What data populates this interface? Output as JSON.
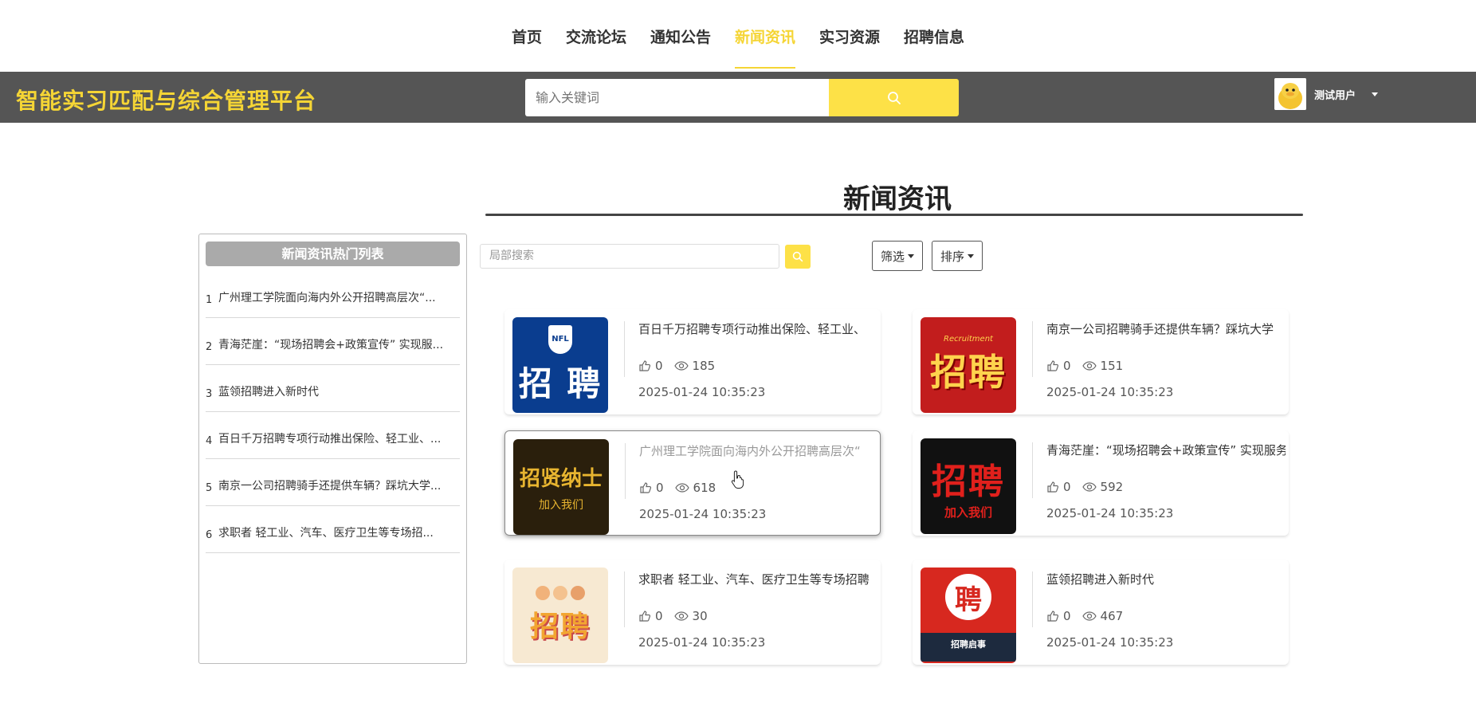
{
  "nav": {
    "items": [
      {
        "label": "首页",
        "active": false
      },
      {
        "label": "交流论坛",
        "active": false
      },
      {
        "label": "通知公告",
        "active": false
      },
      {
        "label": "新闻资讯",
        "active": true
      },
      {
        "label": "实习资源",
        "active": false
      },
      {
        "label": "招聘信息",
        "active": false
      }
    ]
  },
  "header": {
    "brand": "智能实习匹配与综合管理平台",
    "search_placeholder": "输入关键词",
    "user_name": "测试用户"
  },
  "page": {
    "title": "新闻资讯",
    "local_search_placeholder": "局部搜索",
    "filter_label": "筛选",
    "sort_label": "排序"
  },
  "sidebar": {
    "title": "新闻资讯热门列表",
    "items": [
      {
        "idx": "1",
        "text": "广州理工学院面向海内外公开招聘高层次“..."
      },
      {
        "idx": "2",
        "text": "青海茫崖：“现场招聘会+政策宣传” 实现服..."
      },
      {
        "idx": "3",
        "text": "蓝领招聘进入新时代"
      },
      {
        "idx": "4",
        "text": "百日千万招聘专项行动推出保险、轻工业、..."
      },
      {
        "idx": "5",
        "text": "南京一公司招聘骑手还提供车辆？踩坑大学..."
      },
      {
        "idx": "6",
        "text": "求职者 轻工业、汽车、医疗卫生等专场招..."
      }
    ]
  },
  "cards": [
    {
      "title": "百日千万招聘专项行动推出保险、轻工业、",
      "likes": "0",
      "views": "185",
      "time": "2025-01-24 10:35:23",
      "thumb_text": "招 聘",
      "thumb_sub": "NFL"
    },
    {
      "title": "南京一公司招聘骑手还提供车辆？踩坑大学",
      "likes": "0",
      "views": "151",
      "time": "2025-01-24 10:35:23",
      "thumb_text": "招聘",
      "thumb_sub": "Recruitment"
    },
    {
      "title": "广州理工学院面向海内外公开招聘高层次“",
      "likes": "0",
      "views": "618",
      "time": "2025-01-24 10:35:23",
      "thumb_text": "招贤纳士",
      "thumb_sub": "加入我们"
    },
    {
      "title": "青海茫崖：“现场招聘会+政策宣传” 实现服务",
      "likes": "0",
      "views": "592",
      "time": "2025-01-24 10:35:23",
      "thumb_text": "招聘",
      "thumb_sub": "加入我们"
    },
    {
      "title": "求职者 轻工业、汽车、医疗卫生等专场招聘",
      "likes": "0",
      "views": "30",
      "time": "2025-01-24 10:35:23",
      "thumb_text": "招聘",
      "thumb_sub": ""
    },
    {
      "title": "蓝领招聘进入新时代",
      "likes": "0",
      "views": "467",
      "time": "2025-01-24 10:35:23",
      "thumb_text": "聘",
      "thumb_sub": "招聘启事"
    }
  ],
  "colors": {
    "accent": "#f5d535",
    "header_bg": "#555555",
    "button_yellow": "#fde147"
  }
}
